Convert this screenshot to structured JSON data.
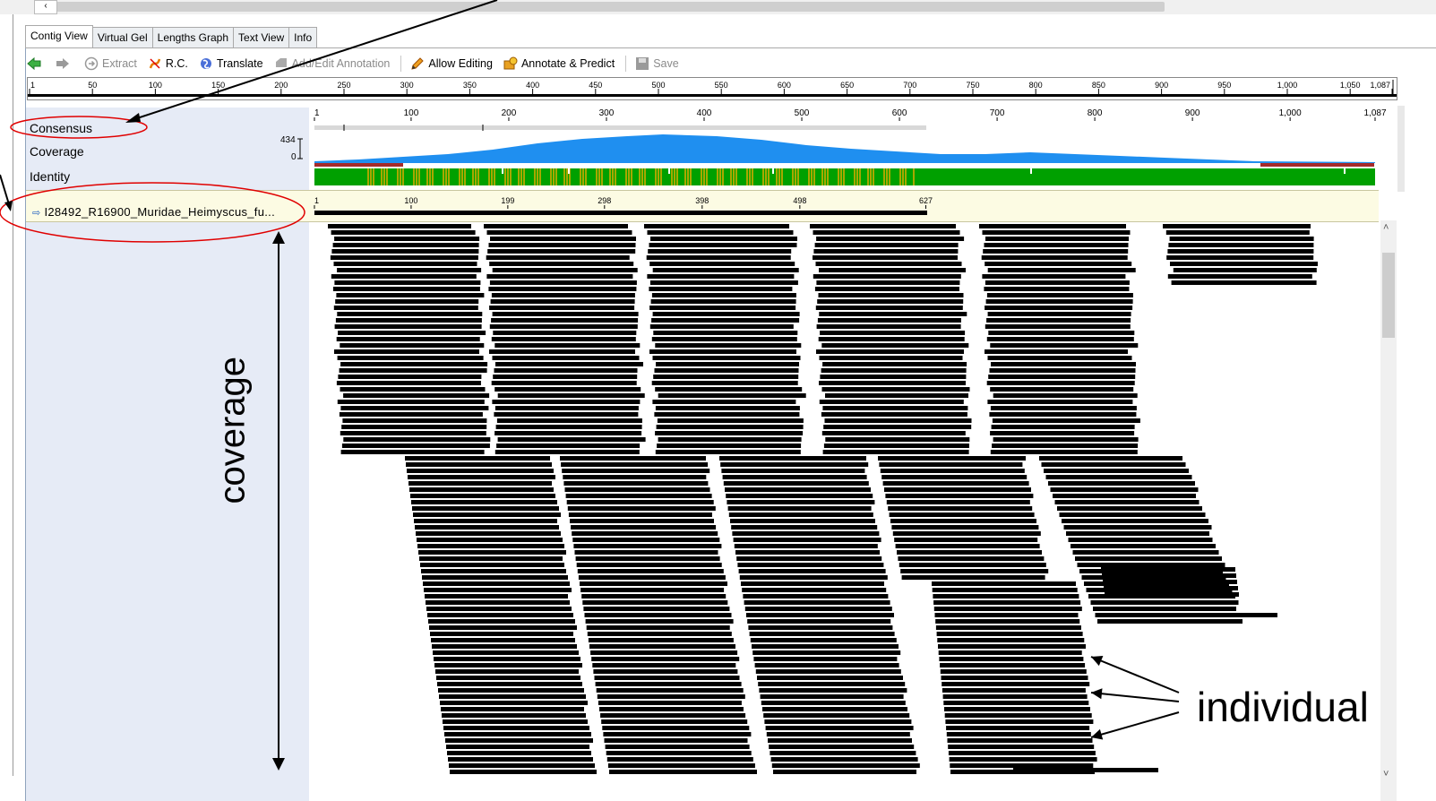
{
  "tabs": [
    {
      "label": "Contig View",
      "active": true
    },
    {
      "label": "Virtual Gel",
      "active": false
    },
    {
      "label": "Lengths Graph",
      "active": false
    },
    {
      "label": "Text View",
      "active": false
    },
    {
      "label": "Info",
      "active": false
    }
  ],
  "toolbar": {
    "extract": "Extract",
    "rc": "R.C.",
    "translate": "Translate",
    "add_edit": "Add/Edit Annotation",
    "allow_editing": "Allow Editing",
    "annotate_predict": "Annotate & Predict",
    "save": "Save"
  },
  "overview_ruler": {
    "labels": [
      "1",
      "50",
      "100",
      "150",
      "200",
      "250",
      "300",
      "350",
      "400",
      "450",
      "500",
      "550",
      "600",
      "650",
      "700",
      "750",
      "800",
      "850",
      "900",
      "950",
      "1,000",
      "1,050",
      "1,087"
    ]
  },
  "track_ruler": {
    "labels": [
      "1",
      "100",
      "200",
      "300",
      "400",
      "500",
      "600",
      "700",
      "800",
      "900",
      "1,000",
      "1,087"
    ]
  },
  "tracks": {
    "consensus": "Consensus",
    "coverage": "Coverage",
    "identity": "Identity",
    "coverage_max": "434",
    "coverage_min": "0"
  },
  "sequence": {
    "name": "I28492_R16900_Muridae_Heimyscus_fu...",
    "ticks": [
      "1",
      "100",
      "199",
      "298",
      "398",
      "498",
      "627"
    ]
  },
  "annotations": {
    "coverage": "coverage",
    "individual": "individual"
  },
  "colors": {
    "coverage_fill": "#1f8ff0",
    "identity_green": "#00a000",
    "identity_olive": "#a8a800",
    "low_coverage_red": "#a52a2a",
    "read_black": "#000000",
    "highlight_red": "#e00000",
    "left_pane": "#e6ebf6",
    "sequence_row": "#fcfbe3"
  }
}
